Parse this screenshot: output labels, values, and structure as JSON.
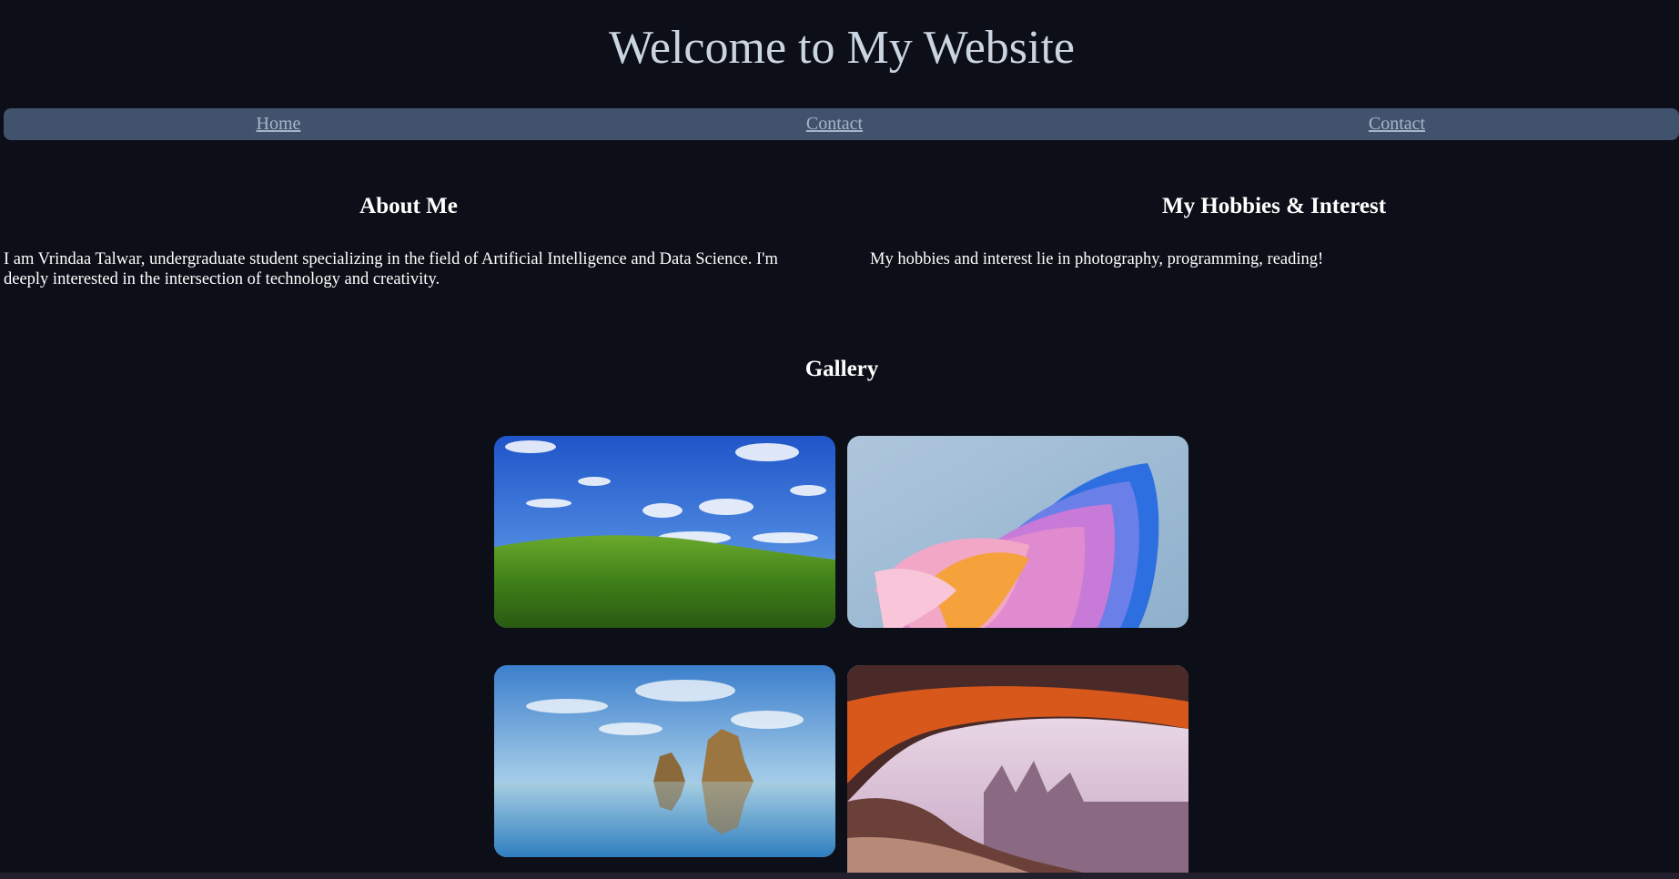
{
  "header": {
    "title": "Welcome to My Website"
  },
  "nav": {
    "items": [
      "Home",
      "Contact",
      "Contact"
    ]
  },
  "about": {
    "heading": "About Me",
    "text": "I am Vrindaa Talwar, undergraduate student specializing in the field of Artificial Intelligence and Data Science. I'm deeply interested in the intersection of technology and creativity."
  },
  "hobbies": {
    "heading": "My Hobbies & Interest",
    "text": "My hobbies and interest lie in photography, programming, reading!"
  },
  "gallery": {
    "heading": "Gallery",
    "images": [
      "green-hill-sky-image",
      "abstract-pink-bloom-image",
      "sea-rocks-reflection-image",
      "red-rock-arch-image"
    ]
  },
  "colors": {
    "background": "#0c0f17",
    "nav_background": "#41526c",
    "title_text": "#cbd5e1",
    "nav_link": "#a7b5c9"
  }
}
